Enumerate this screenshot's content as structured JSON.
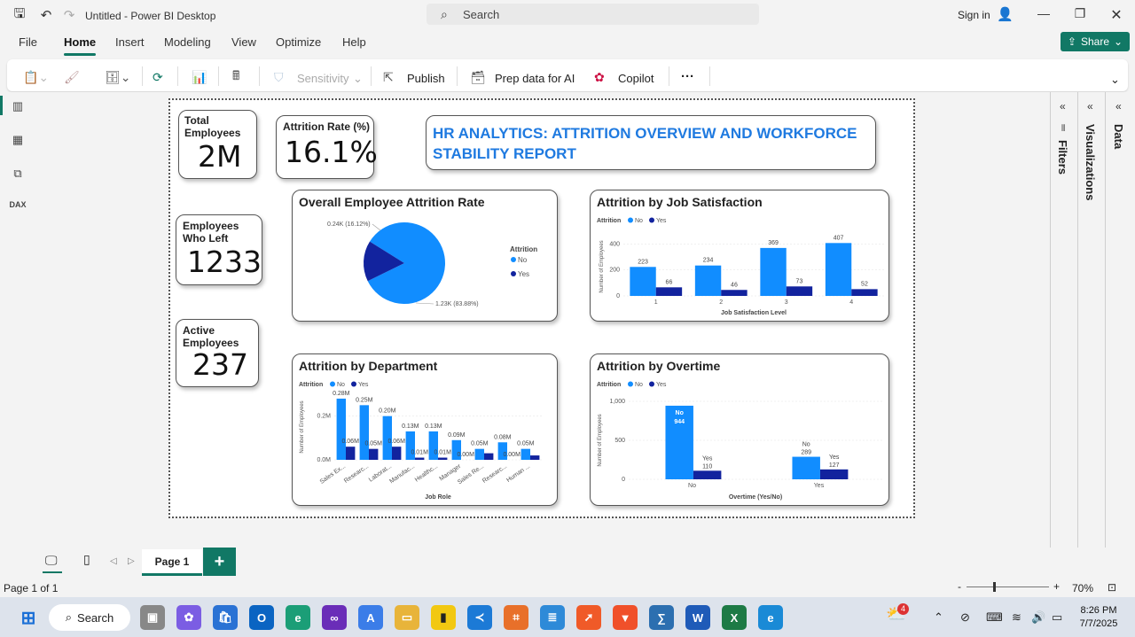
{
  "window": {
    "title": "Untitled - Power BI Desktop",
    "search_placeholder": "Search",
    "signin": "Sign in"
  },
  "menu": {
    "items": [
      "File",
      "Home",
      "Insert",
      "Modeling",
      "View",
      "Optimize",
      "Help"
    ],
    "share": "Share"
  },
  "ribbon": {
    "sensitivity": "Sensitivity",
    "publish": "Publish",
    "prep": "Prep data for AI",
    "copilot": "Copilot",
    "more": "···"
  },
  "kpis": {
    "total": {
      "label1": "Total",
      "label2": "Employees",
      "value": "2M"
    },
    "attrition": {
      "label": "Attrition Rate (%)",
      "value": "16.1%"
    },
    "left": {
      "label1": "Employees",
      "label2": "Who Left",
      "value": "1233"
    },
    "active": {
      "label1": "Active",
      "label2": "Employees",
      "value": "237"
    }
  },
  "report_title": "HR ANALYTICS: ATTRITION OVERVIEW AND WORKFORCE STABILITY REPORT",
  "panes": {
    "filters": "Filters",
    "visualizations": "Visualizations",
    "data": "Data"
  },
  "pages": {
    "tab": "Page 1",
    "add": "+"
  },
  "status": {
    "page": "Page 1 of 1",
    "zoom": "70%"
  },
  "taskbar": {
    "search": "Search",
    "time": "8:26 PM",
    "date": "7/7/2025",
    "badge": "4"
  },
  "colors": {
    "no": "#118dff",
    "yes": "#12239e",
    "accent": "#117865",
    "title": "#1f7ae0"
  },
  "chart_data": [
    {
      "type": "pie",
      "title": "Overall Employee Attrition Rate",
      "legend_title": "Attrition",
      "legend": [
        "No",
        "Yes"
      ],
      "slices": [
        {
          "name": "No",
          "value": 1233,
          "label": "1.23K (83.88%)"
        },
        {
          "name": "Yes",
          "value": 237,
          "label": "0.24K (16.12%)"
        }
      ]
    },
    {
      "type": "bar",
      "title": "Attrition by Job Satisfaction",
      "legend_title": "Attrition",
      "legend": [
        "No",
        "Yes"
      ],
      "xlabel": "Job Satisfaction Level",
      "ylabel": "Number of Employees",
      "categories": [
        "1",
        "2",
        "3",
        "4"
      ],
      "yticks": [
        "0",
        "200",
        "400"
      ],
      "ylim": [
        0,
        450
      ],
      "series": [
        {
          "name": "No",
          "values": [
            223,
            234,
            369,
            407
          ]
        },
        {
          "name": "Yes",
          "values": [
            66,
            46,
            73,
            52
          ]
        }
      ]
    },
    {
      "type": "bar",
      "title": "Attrition by Department",
      "legend_title": "Attrition",
      "legend": [
        "No",
        "Yes"
      ],
      "xlabel": "Job Role",
      "ylabel": "Number of Employees",
      "yticks": [
        "0.0M",
        "0.2M"
      ],
      "ylim": [
        0,
        0.3
      ],
      "categories": [
        "Sales Ex...",
        "Researc...",
        "Laborat...",
        "Manufac...",
        "Healthc...",
        "Manager",
        "Sales Re...",
        "Researc...",
        "Human ..."
      ],
      "series": [
        {
          "name": "No",
          "values": [
            0.28,
            0.25,
            0.2,
            0.13,
            0.13,
            0.09,
            0.05,
            0.08,
            0.05
          ],
          "labels": [
            "0.28M",
            "0.25M",
            "0.20M",
            "0.13M",
            "0.13M",
            "0.09M",
            "0.05M",
            "0.08M",
            "0.05M"
          ]
        },
        {
          "name": "Yes",
          "values": [
            0.06,
            0.05,
            0.06,
            0.01,
            0.01,
            0.0,
            0.03,
            0.0,
            0.02
          ],
          "labels": [
            "0.06M",
            "0.05M",
            "0.06M",
            "0.01M",
            "0.01M",
            "0.00M",
            "",
            "0.00M",
            ""
          ]
        }
      ]
    },
    {
      "type": "bar",
      "title": "Attrition by Overtime",
      "legend_title": "Attrition",
      "legend": [
        "No",
        "Yes"
      ],
      "xlabel": "Overtime (Yes/No)",
      "ylabel": "Number of Employees",
      "categories": [
        "No",
        "Yes"
      ],
      "yticks": [
        "0",
        "500",
        "1,000"
      ],
      "ylim": [
        0,
        1000
      ],
      "series": [
        {
          "name": "No",
          "values": [
            944,
            289
          ]
        },
        {
          "name": "Yes",
          "values": [
            110,
            127
          ]
        }
      ]
    }
  ]
}
